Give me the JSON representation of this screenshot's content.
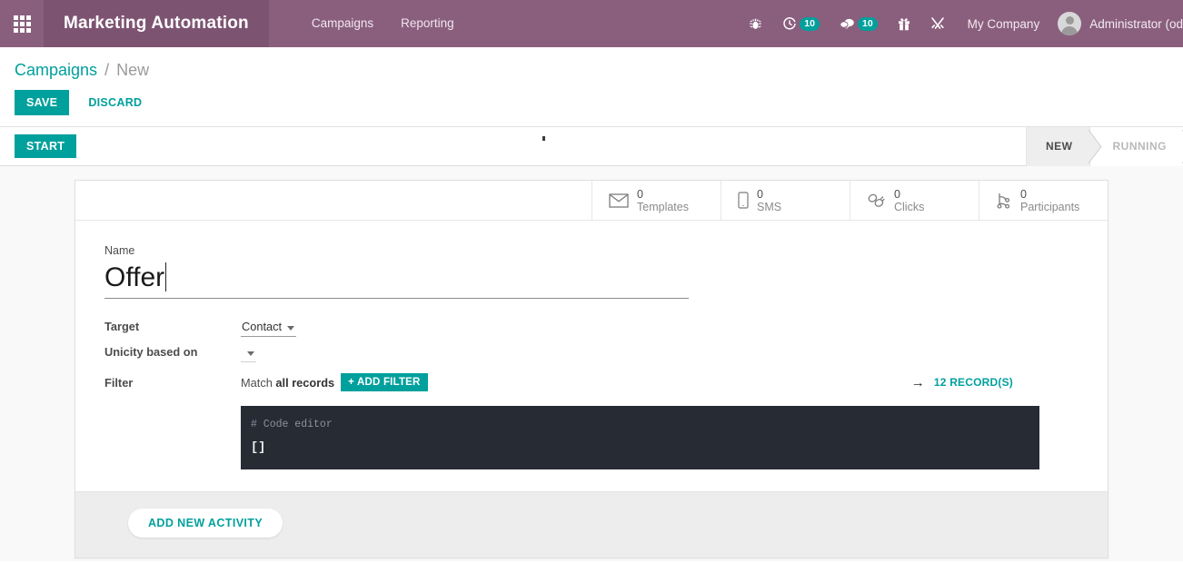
{
  "navbar": {
    "apps_icon": "apps-grid-icon",
    "app_title": "Marketing Automation",
    "menu_items": [
      {
        "label": "Campaigns"
      },
      {
        "label": "Reporting"
      }
    ],
    "icons": [
      {
        "name": "bug-icon",
        "badge": ""
      },
      {
        "name": "activities-clock-icon",
        "badge": "10"
      },
      {
        "name": "messages-icon",
        "badge": "10"
      },
      {
        "name": "gift-icon",
        "badge": ""
      },
      {
        "name": "tools-icon",
        "badge": ""
      }
    ],
    "company": "My Company",
    "user": "Administrator (od"
  },
  "control_panel": {
    "breadcrumb_root": "Campaigns",
    "breadcrumb_sep": "/",
    "breadcrumb_current": "New",
    "save_label": "SAVE",
    "discard_label": "DISCARD"
  },
  "statusbar": {
    "start_label": "START",
    "stages": [
      {
        "label": "NEW",
        "active": true
      },
      {
        "label": "RUNNING",
        "active": false
      }
    ]
  },
  "smart_buttons": [
    {
      "icon": "envelope-icon",
      "value": "0",
      "label": "Templates"
    },
    {
      "icon": "mobile-icon",
      "value": "0",
      "label": "SMS"
    },
    {
      "icon": "link-chain-icon",
      "value": "0",
      "label": "Clicks"
    },
    {
      "icon": "participants-icon",
      "value": "0",
      "label": "Participants"
    }
  ],
  "form": {
    "name_label": "Name",
    "name_value": "Offer",
    "target_label": "Target",
    "target_value": "Contact",
    "unicity_label": "Unicity based on",
    "unicity_value": "",
    "filter_label": "Filter",
    "filter_match_prefix": "Match",
    "filter_match_value": "all records",
    "add_filter_label": "+ ADD FILTER",
    "records_arrow": "→",
    "records_label": "12 RECORD(S)",
    "code_comment": "# Code editor",
    "code_value": "[]"
  },
  "activity": {
    "add_activity_label": "ADD NEW ACTIVITY"
  },
  "colors": {
    "brand_purple": "#8a5f7e",
    "brand_purple_dark": "#7d5372",
    "accent_teal": "#00a09d",
    "code_bg": "#272b33",
    "activity_bg": "#ededed"
  }
}
